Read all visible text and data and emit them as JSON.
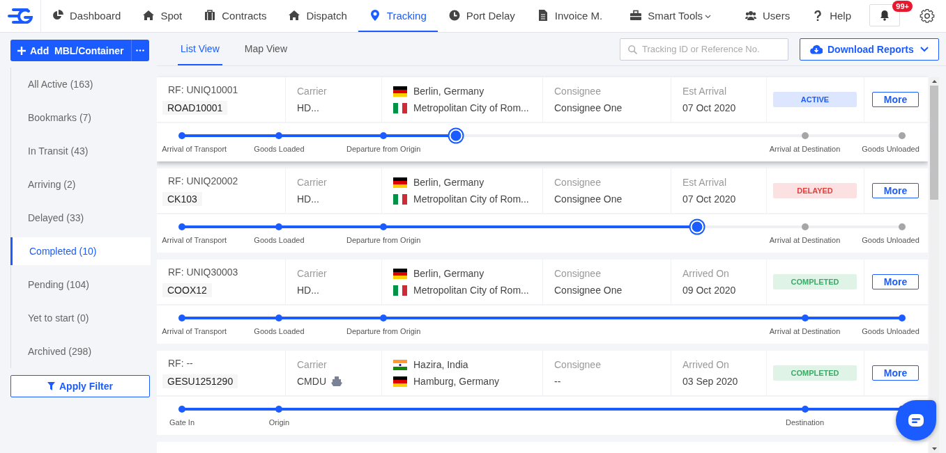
{
  "nav": {
    "items": [
      {
        "label": "Dashboard",
        "selected": false
      },
      {
        "label": "Spot",
        "selected": false
      },
      {
        "label": "Contracts",
        "selected": false
      },
      {
        "label": "Dispatch",
        "selected": false
      },
      {
        "label": "Tracking",
        "selected": true
      },
      {
        "label": "Port Delay",
        "selected": false
      },
      {
        "label": "Invoice M.",
        "selected": false
      },
      {
        "label": "Smart Tools",
        "selected": false
      },
      {
        "label": "Users",
        "selected": false
      },
      {
        "label": "Help",
        "selected": false
      }
    ],
    "notifications": {
      "badge": "99+"
    }
  },
  "sidebar": {
    "add_button": "Add  MBL/Container",
    "filters": [
      {
        "label": "All Active (163)",
        "selected": false
      },
      {
        "label": "Bookmarks (7)",
        "selected": false
      },
      {
        "label": "In Transit (43)",
        "selected": false
      },
      {
        "label": "Arriving (2)",
        "selected": false
      },
      {
        "label": "Delayed (33)",
        "selected": false
      },
      {
        "label": "Completed (10)",
        "selected": true
      },
      {
        "label": "Pending (104)",
        "selected": false
      },
      {
        "label": "Yet to start (0)",
        "selected": false
      },
      {
        "label": "Archived (298)",
        "selected": false
      }
    ],
    "apply_button": "Apply Filter"
  },
  "views": {
    "tabs": [
      {
        "label": "List View",
        "selected": true
      },
      {
        "label": "Map View",
        "selected": false
      }
    ],
    "search": {
      "placeholder": "Tracking ID or Reference No."
    },
    "download_button": "Download Reports"
  },
  "shipments": [
    {
      "selected": true,
      "ref": "RF: UNIQ10001",
      "container": "ROAD10001",
      "carrier_label": "Carrier",
      "carrier": "HD...",
      "ship": false,
      "origin": {
        "kind": "de",
        "place": "Berlin, Germany"
      },
      "destination": {
        "kind": "it",
        "place": "Metropolitan City of Rom..."
      },
      "consignee_label": "Consignee",
      "consignee": "Consignee One",
      "date_label": "Est Arrival",
      "date": "07 Oct 2020",
      "status": {
        "label": "ACTIVE",
        "kind": "active"
      },
      "more_button": "More",
      "progress": {
        "level": 0.38,
        "steps": [
          {
            "label": "Arrival of Transport",
            "done": true,
            "current": false
          },
          {
            "label": "Goods Loaded",
            "done": true,
            "current": false
          },
          {
            "label": "Departure from Origin",
            "done": true,
            "current": false
          },
          {
            "current": true
          },
          {
            "label": "Arrival at Destination",
            "done": false,
            "current": false
          },
          {
            "label": "Goods Unloaded",
            "done": false,
            "current": false
          }
        ]
      }
    },
    {
      "selected": false,
      "ref": "RF: UNIQ20002",
      "container": "CK103",
      "carrier_label": "Carrier",
      "carrier": "HD...",
      "ship": false,
      "origin": {
        "kind": "de",
        "place": "Berlin, Germany"
      },
      "destination": {
        "kind": "it",
        "place": "Metropolitan City of Rom..."
      },
      "consignee_label": "Consignee",
      "consignee": "Consignee One",
      "date_label": "Est Arrival",
      "date": "07 Oct 2020",
      "status": {
        "label": "DELAYED",
        "kind": "delayed"
      },
      "more_button": "More",
      "progress": {
        "level": 0.715,
        "steps": [
          {
            "label": "Arrival of Transport",
            "done": true,
            "current": false
          },
          {
            "label": "Goods Loaded",
            "done": true,
            "current": false
          },
          {
            "label": "Departure from Origin",
            "done": true,
            "current": false
          },
          {
            "current": true
          },
          {
            "label": "Arrival at Destination",
            "done": false,
            "current": false
          },
          {
            "label": "Goods Unloaded",
            "done": false,
            "current": false
          }
        ]
      }
    },
    {
      "selected": false,
      "ref": "RF: UNIQ30003",
      "container": "COOX12",
      "carrier_label": "Carrier",
      "carrier": "HD...",
      "ship": false,
      "origin": {
        "kind": "de",
        "place": "Berlin, Germany"
      },
      "destination": {
        "kind": "it",
        "place": "Metropolitan City of Rom..."
      },
      "consignee_label": "Consignee",
      "consignee": "Consignee One",
      "date_label": "Arrived On",
      "date": "09 Oct 2020",
      "status": {
        "label": "COMPLETED",
        "kind": "completed"
      },
      "more_button": "More",
      "progress": {
        "level": 1,
        "steps": [
          {
            "label": "Arrival of Transport",
            "done": true,
            "current": false
          },
          {
            "label": "Goods Loaded",
            "done": true,
            "current": false
          },
          {
            "label": "Departure from Origin",
            "done": true,
            "current": false
          },
          {
            "label": "Arrival at Destination",
            "done": true,
            "current": false
          },
          {
            "label": "Goods Unloaded",
            "done": true,
            "current": false
          }
        ]
      }
    },
    {
      "selected": false,
      "ref": "RF: --",
      "container": "GESU1251290",
      "carrier_label": "Carrier",
      "carrier": "CMDU",
      "ship": true,
      "origin": {
        "kind": "in",
        "place": "Hazira, India"
      },
      "destination": {
        "kind": "de",
        "place": "Hamburg, Germany"
      },
      "consignee_label": "Consignee",
      "consignee": "--",
      "date_label": "Arrived On",
      "date": "03 Sep 2020",
      "status": {
        "label": "COMPLETED",
        "kind": "completed"
      },
      "more_button": "More",
      "progress": {
        "level": 1,
        "steps": [
          {
            "label": "Gate In",
            "done": true,
            "current": false
          },
          {
            "label": "Origin",
            "done": true,
            "current": false
          },
          {
            "label": "Destination",
            "done": true,
            "current": false
          },
          {
            "done": true,
            "current": false
          }
        ]
      }
    }
  ]
}
